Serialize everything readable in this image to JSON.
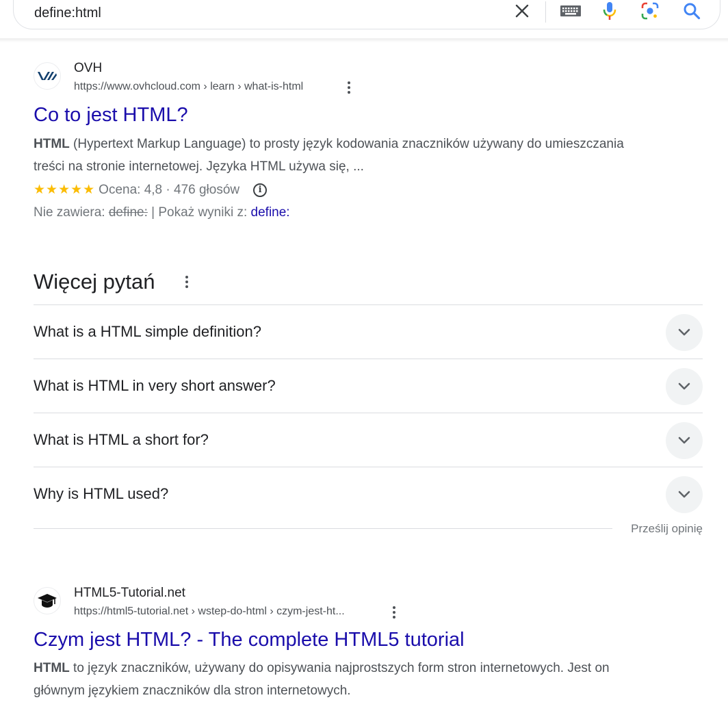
{
  "search": {
    "query": "define:html"
  },
  "results": [
    {
      "site_name": "OVH",
      "url": "https://www.ovhcloud.com › learn › what-is-html",
      "title": "Co to jest HTML?",
      "snippet_bold": "HTML",
      "snippet_rest": " (Hypertext Markup Language) to prosty język kodowania znaczników używany do umieszczania treści na stronie internetowej. Języka HTML używa się, ...",
      "stars": "★★★★★",
      "rating_text": "Ocena: 4,8 · 476 głosów",
      "missing_label": "Nie zawiera: ",
      "missing_term": "define:",
      "show_results_label": " | Pokaż wyniki z: ",
      "show_results_term": "define:"
    },
    {
      "site_name": "HTML5-Tutorial.net",
      "url": "https://html5-tutorial.net › wstep-do-html › czym-jest-ht...",
      "title": "Czym jest HTML? - The complete HTML5 tutorial",
      "snippet_bold": "HTML",
      "snippet_rest": " to język znaczników, używany do opisywania najprostszych form stron internetowych. Jest on głównym językiem znaczników dla stron internetowych."
    }
  ],
  "paa": {
    "title": "Więcej pytań",
    "questions": [
      "What is a HTML simple definition?",
      "What is HTML in very short answer?",
      "What is HTML a short for?",
      "Why is HTML used?"
    ],
    "feedback": "Prześlij opinię"
  },
  "icons": {
    "clear": "close-icon",
    "keyboard": "keyboard-icon",
    "voice": "microphone-icon",
    "lens": "lens-icon",
    "search": "search-icon",
    "more": "more-vert-icon",
    "expand": "chevron-down-icon",
    "info": "info-icon"
  }
}
